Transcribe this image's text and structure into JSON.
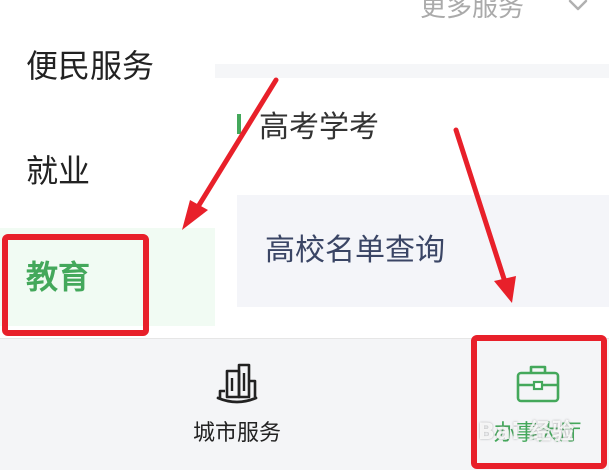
{
  "sidebar": {
    "items": [
      {
        "label": "便民服务",
        "selected": false
      },
      {
        "label": "就业",
        "selected": false
      },
      {
        "label": "教育",
        "selected": true
      }
    ]
  },
  "content": {
    "more_services_label": "更多服务",
    "more_services_icon": "chevron-down-icon",
    "section": {
      "title": "高考学考",
      "items": [
        {
          "label": "高校名单查询"
        }
      ]
    }
  },
  "tabbar": {
    "tabs": [
      {
        "label": "城市服务",
        "icon": "city-buildings-icon",
        "active": false
      },
      {
        "label": "办事大厅",
        "icon": "briefcase-icon",
        "active": true
      }
    ]
  },
  "watermark": {
    "text": "Bai 经验"
  },
  "colors": {
    "accent_green": "#44a85b",
    "selected_bg": "#f1fbf3",
    "annotation_red": "#e8202a"
  }
}
